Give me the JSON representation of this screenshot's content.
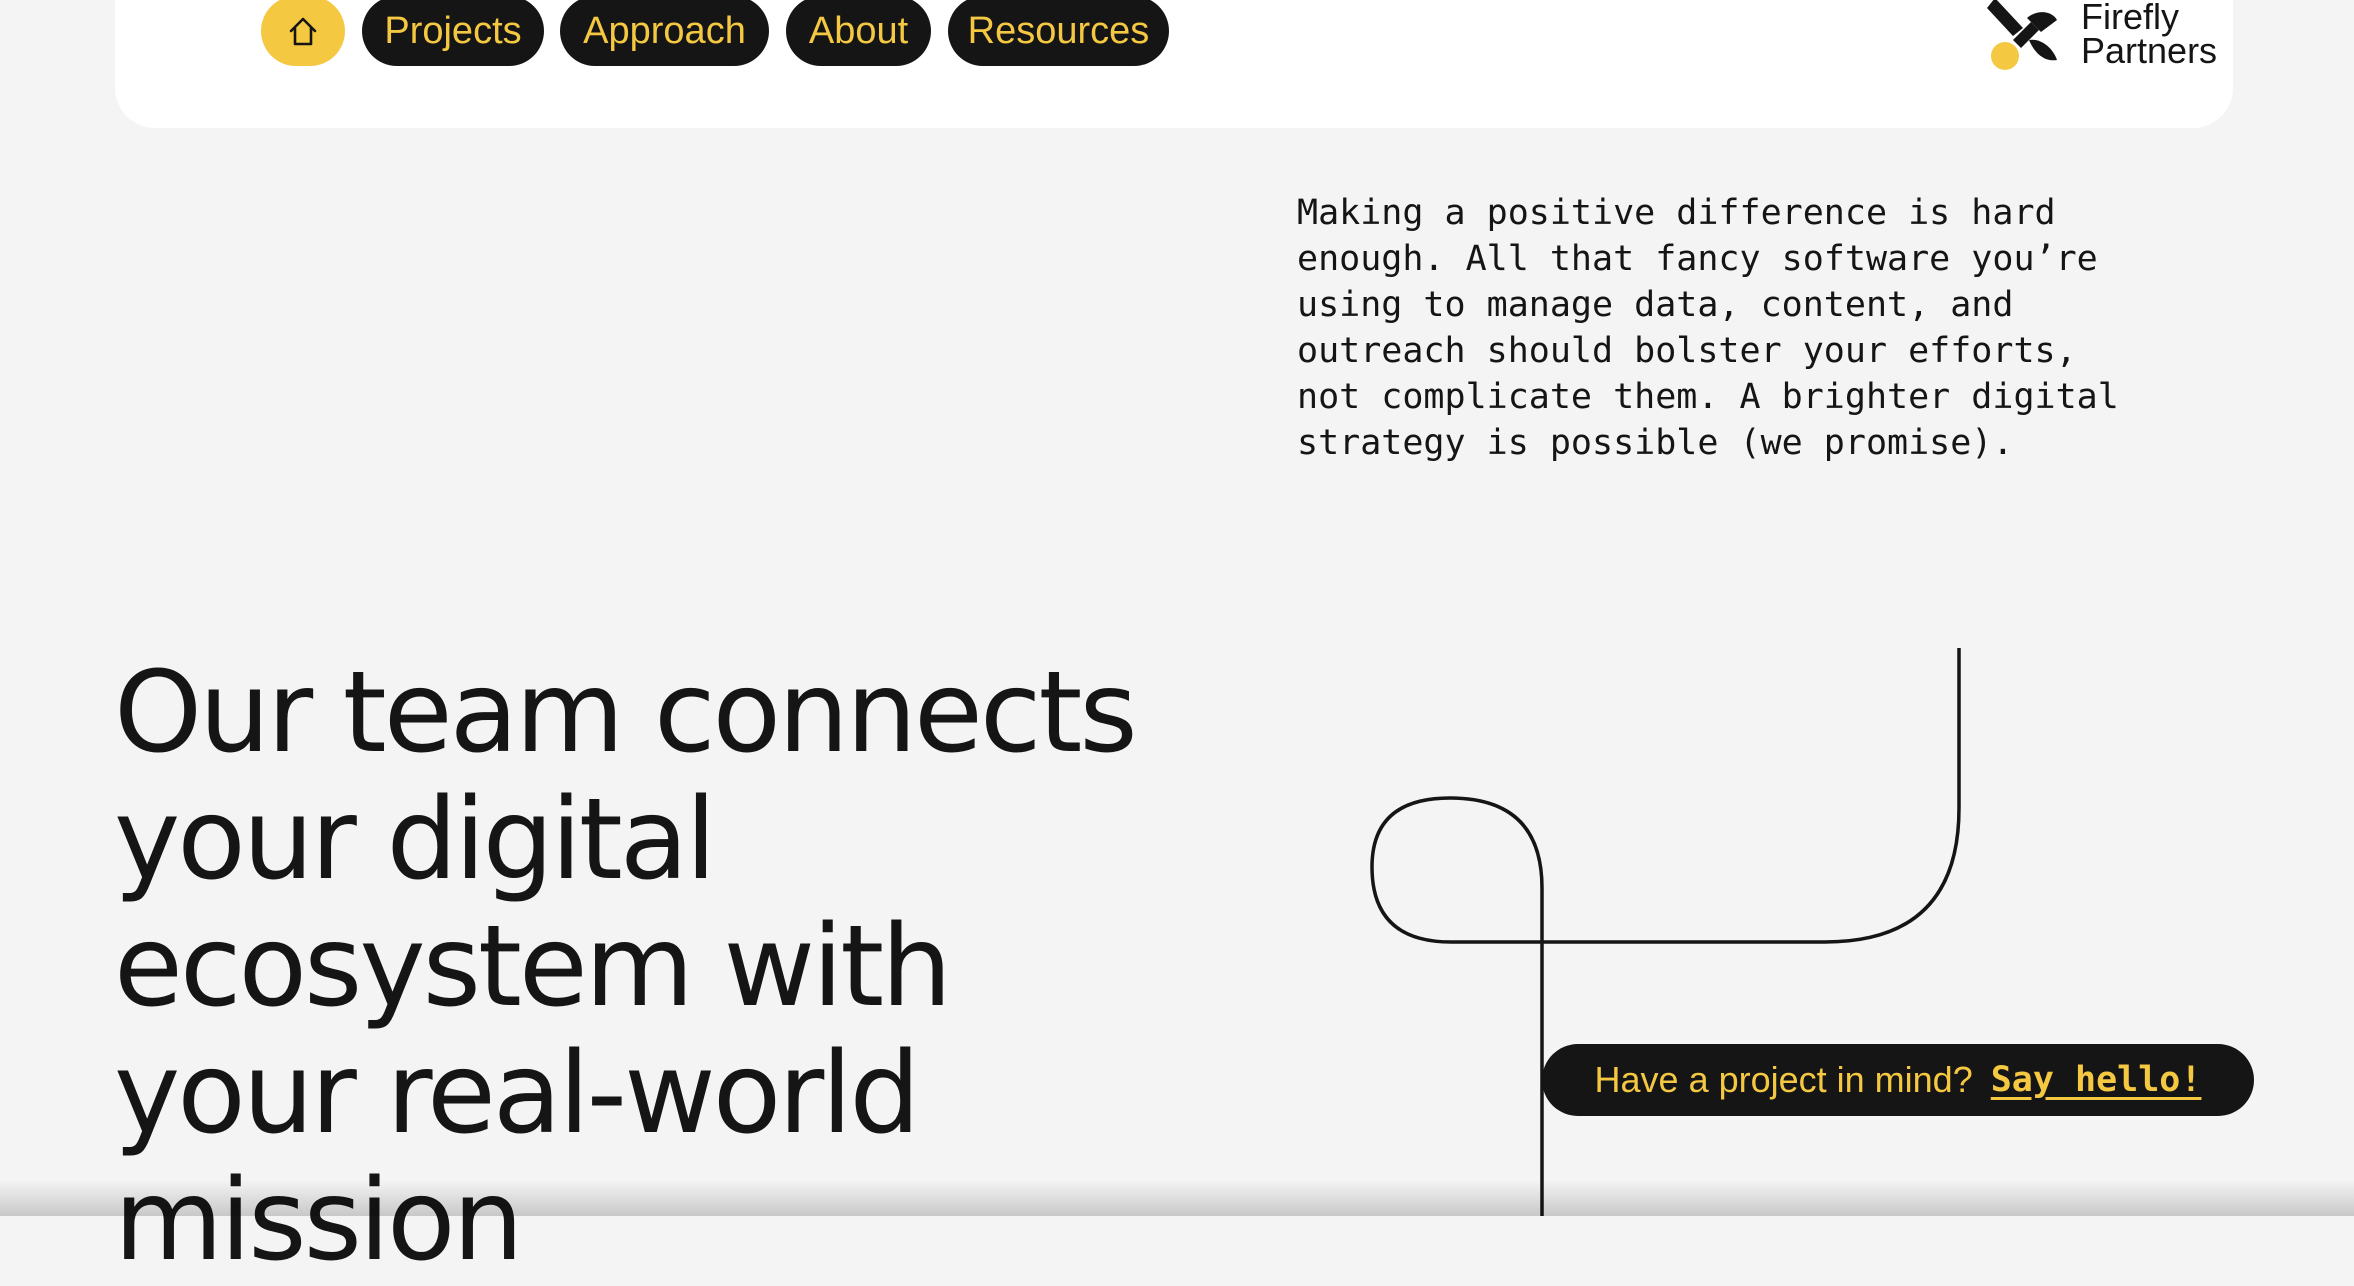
{
  "nav": {
    "home_label": "Home",
    "items": [
      {
        "label": "Projects"
      },
      {
        "label": "Approach"
      },
      {
        "label": "About"
      },
      {
        "label": "Resources"
      }
    ]
  },
  "brand": {
    "name_line1": "Firefly",
    "name_line2": "Partners"
  },
  "intro": {
    "lines": [
      "Making a positive difference is hard",
      "enough. All that fancy software you’re",
      "using to manage data, content, and",
      "outreach should bolster your efforts,",
      "not complicate them. A brighter digital",
      "strategy is possible (we promise)."
    ]
  },
  "hero": {
    "lines": [
      "Our team connects",
      "your digital",
      "ecosystem with",
      "your real-world",
      "mission"
    ]
  },
  "cta": {
    "text": "Have a project in mind?",
    "link": "Say hello!"
  },
  "icons": {
    "home": "home-icon",
    "logo": "firefly-logo-icon"
  },
  "colors": {
    "accent": "#f5c842",
    "dark": "#151515",
    "page_bg": "#f4f4f4",
    "nav_bg": "#ffffff"
  }
}
